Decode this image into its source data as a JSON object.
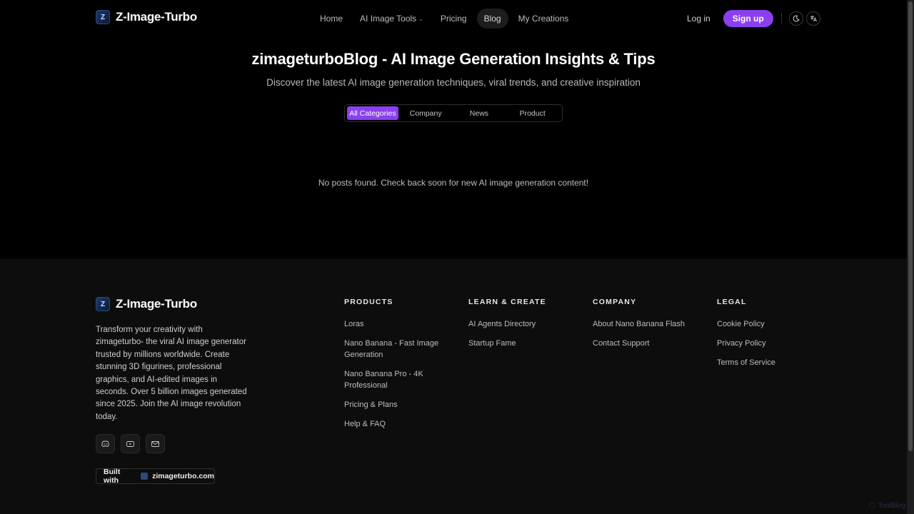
{
  "brand": {
    "name": "Z-Image-Turbo",
    "mark": "Z"
  },
  "nav": {
    "items": [
      {
        "label": "Home"
      },
      {
        "label": "AI Image Tools"
      },
      {
        "label": "Pricing"
      },
      {
        "label": "Blog"
      },
      {
        "label": "My Creations"
      }
    ],
    "active": "Blog"
  },
  "auth": {
    "login": "Log in",
    "signup": "Sign up"
  },
  "icons": {
    "theme": "moon-icon",
    "language": "translate-icon"
  },
  "hero": {
    "title": "zimageturboBlog - AI Image Generation Insights & Tips",
    "subtitle": "Discover the latest AI image generation techniques, viral trends, and creative inspiration"
  },
  "tabs": [
    "All Categories",
    "Company",
    "News",
    "Product"
  ],
  "active_tab": "All Categories",
  "empty_message": "No posts found. Check back soon for new AI image generation content!",
  "footer": {
    "description": "Transform your creativity with zimageturbo- the viral AI image generator trusted by millions worldwide. Create stunning 3D figurines, professional graphics, and AI-edited images in seconds. Over 5 billion images generated since 2025. Join the AI image revolution today.",
    "socials": [
      "discord-icon",
      "youtube-icon",
      "mail-icon"
    ],
    "built_with": {
      "label": "Built with",
      "site": "zimageturbo.com"
    },
    "columns": [
      {
        "title": "PRODUCTS",
        "links": [
          "Loras",
          "Nano Banana - Fast Image Generation",
          "Nano Banana Pro - 4K Professional",
          "Pricing & Plans",
          "Help & FAQ"
        ]
      },
      {
        "title": "LEARN & CREATE",
        "links": [
          "AI Agents Directory",
          "Startup Fame"
        ]
      },
      {
        "title": "COMPANY",
        "links": [
          "About Nano Banana Flash",
          "Contact Support"
        ]
      },
      {
        "title": "LEGAL",
        "links": [
          "Cookie Policy",
          "Privacy Policy",
          "Terms of Service"
        ]
      }
    ]
  },
  "watermark": "ToolBlog",
  "colors": {
    "accent": "#8b3ff0",
    "background": "#000000",
    "footer_bg": "#0d0d0d"
  }
}
